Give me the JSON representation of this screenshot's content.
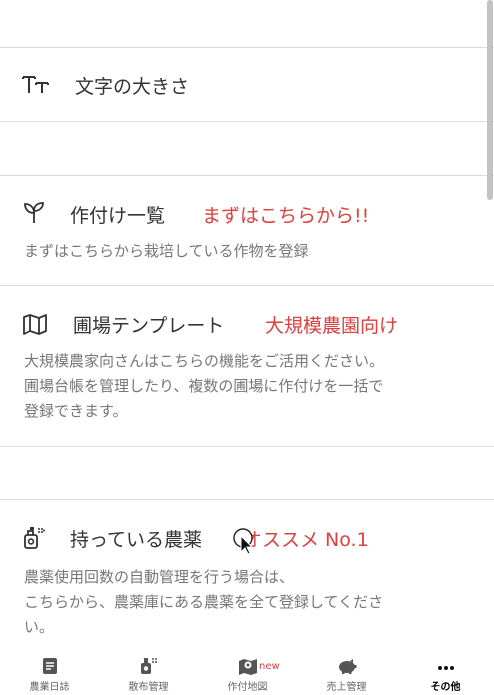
{
  "settings": {
    "font_size_label": "文字の大きさ",
    "crops": {
      "title": "作付け一覧",
      "accent": "まずはこちらから!!",
      "desc": "まずはこちらから栽培している作物を登録"
    },
    "field_template": {
      "title": "圃場テンプレート",
      "accent": "大規模農園向け",
      "desc_lines": [
        "大規模農家向さんはこちらの機能をご活用ください。",
        "圃場台帳を管理したり、複数の圃場に作付けを一括で",
        "登録できます。"
      ]
    },
    "pesticides": {
      "title": "持っている農薬",
      "accent": "オススメ No.1",
      "desc_lines": [
        "農薬使用回数の自動管理を行う場合は、",
        "こちらから、農薬庫にある農薬を全て登録してくださ",
        "い。"
      ]
    }
  },
  "tabbar": {
    "tabs": [
      {
        "label": "農業日誌",
        "icon": "diary-icon"
      },
      {
        "label": "散布管理",
        "icon": "sprayer-icon"
      },
      {
        "label": "作付地図",
        "icon": "map-pin-icon",
        "badge": "new"
      },
      {
        "label": "売上管理",
        "icon": "piggy-bank-icon"
      },
      {
        "label": "その他",
        "icon": "more-dots-icon",
        "active": true
      }
    ]
  },
  "colors": {
    "accent": "#e0403f",
    "divider": "#dcdcdc",
    "text": "#333333",
    "subtext": "#777777"
  }
}
